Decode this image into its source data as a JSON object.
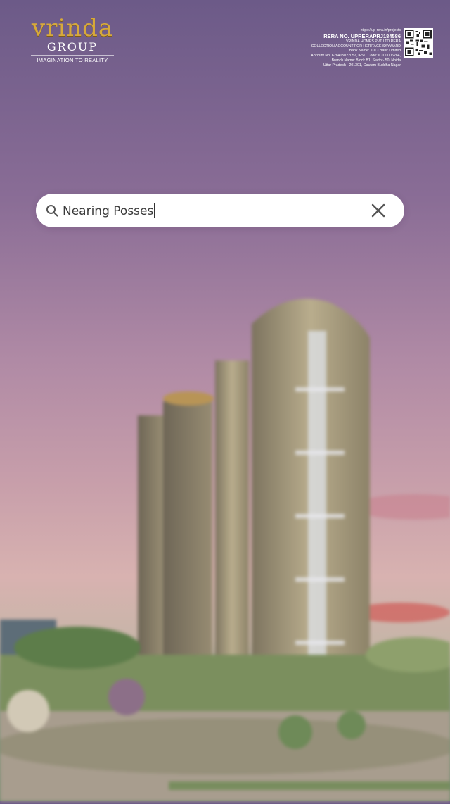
{
  "brand": {
    "name": "vrinda",
    "group": "GROUP",
    "tagline": "IMAGINATION TO REALITY"
  },
  "rera": {
    "url": "https://up-rera.in/projects",
    "number": "RERA NO. UPRERAPRJ184586",
    "line1": "VRINDA HOMES PVT LTD RERA",
    "line2": "COLLECTION ACCOUNT FOR HERITAGE SKYWARD",
    "line3": "Bank Name: ICICI Bank Limited",
    "line4": "Account No. 628405022052, IFSC Code: ICIC0006284,",
    "line5": "Branch Name: Block B1, Sector- 50, Noida",
    "line6": "Uttar Pradesh - 201301, Gautam Buddha Nagar"
  },
  "search": {
    "value": "Nearing Posses",
    "icon": "search-icon",
    "clear_icon": "close-icon"
  },
  "colors": {
    "gold": "#d7a93b",
    "sky_top": "#6c5a88",
    "sky_mid": "#c79eaa"
  }
}
